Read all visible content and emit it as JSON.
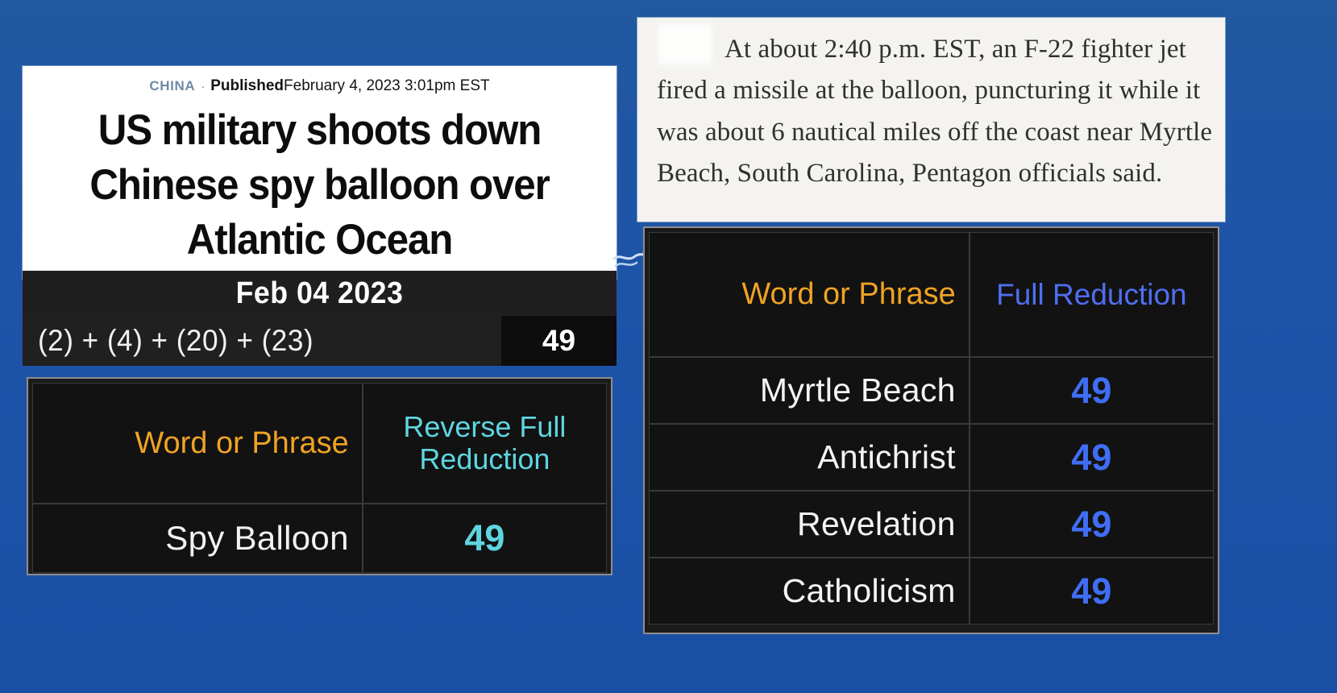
{
  "background_color": "#1d55a6",
  "news_card": {
    "kicker": "CHINA",
    "separator": "·",
    "published_label": "Published",
    "published_date": "February 4, 2023 3:01pm EST",
    "headline": "US military shoots down Chinese spy balloon over Atlantic Ocean"
  },
  "date_bar": {
    "text": "Feb 04 2023"
  },
  "sum_row": {
    "expression": "(2) + (4) + (20) + (23)",
    "value": "49"
  },
  "left_table": {
    "accent_name_color": "#f0a323",
    "accent_value_color": "#5fd5e0",
    "headers": {
      "name": "Word or Phrase",
      "value": "Reverse Full Reduction"
    },
    "rows": [
      {
        "name": "Spy Balloon",
        "value": "49"
      }
    ]
  },
  "article": {
    "text": "At about 2:40 p.m. EST, an F-22 fighter jet fired a missile at the balloon, puncturing it while it was about 6 nautical miles off the coast near Myrtle Beach, South Carolina, Pentagon officials said."
  },
  "right_table": {
    "accent_name_color": "#f0a323",
    "accent_value_color": "#3f6ef5",
    "headers": {
      "name": "Word or Phrase",
      "value": "Full Reduction"
    },
    "rows": [
      {
        "name": "Myrtle Beach",
        "value": "49"
      },
      {
        "name": "Antichrist",
        "value": "49"
      },
      {
        "name": "Revelation",
        "value": "49"
      },
      {
        "name": "Catholicism",
        "value": "49"
      }
    ]
  }
}
